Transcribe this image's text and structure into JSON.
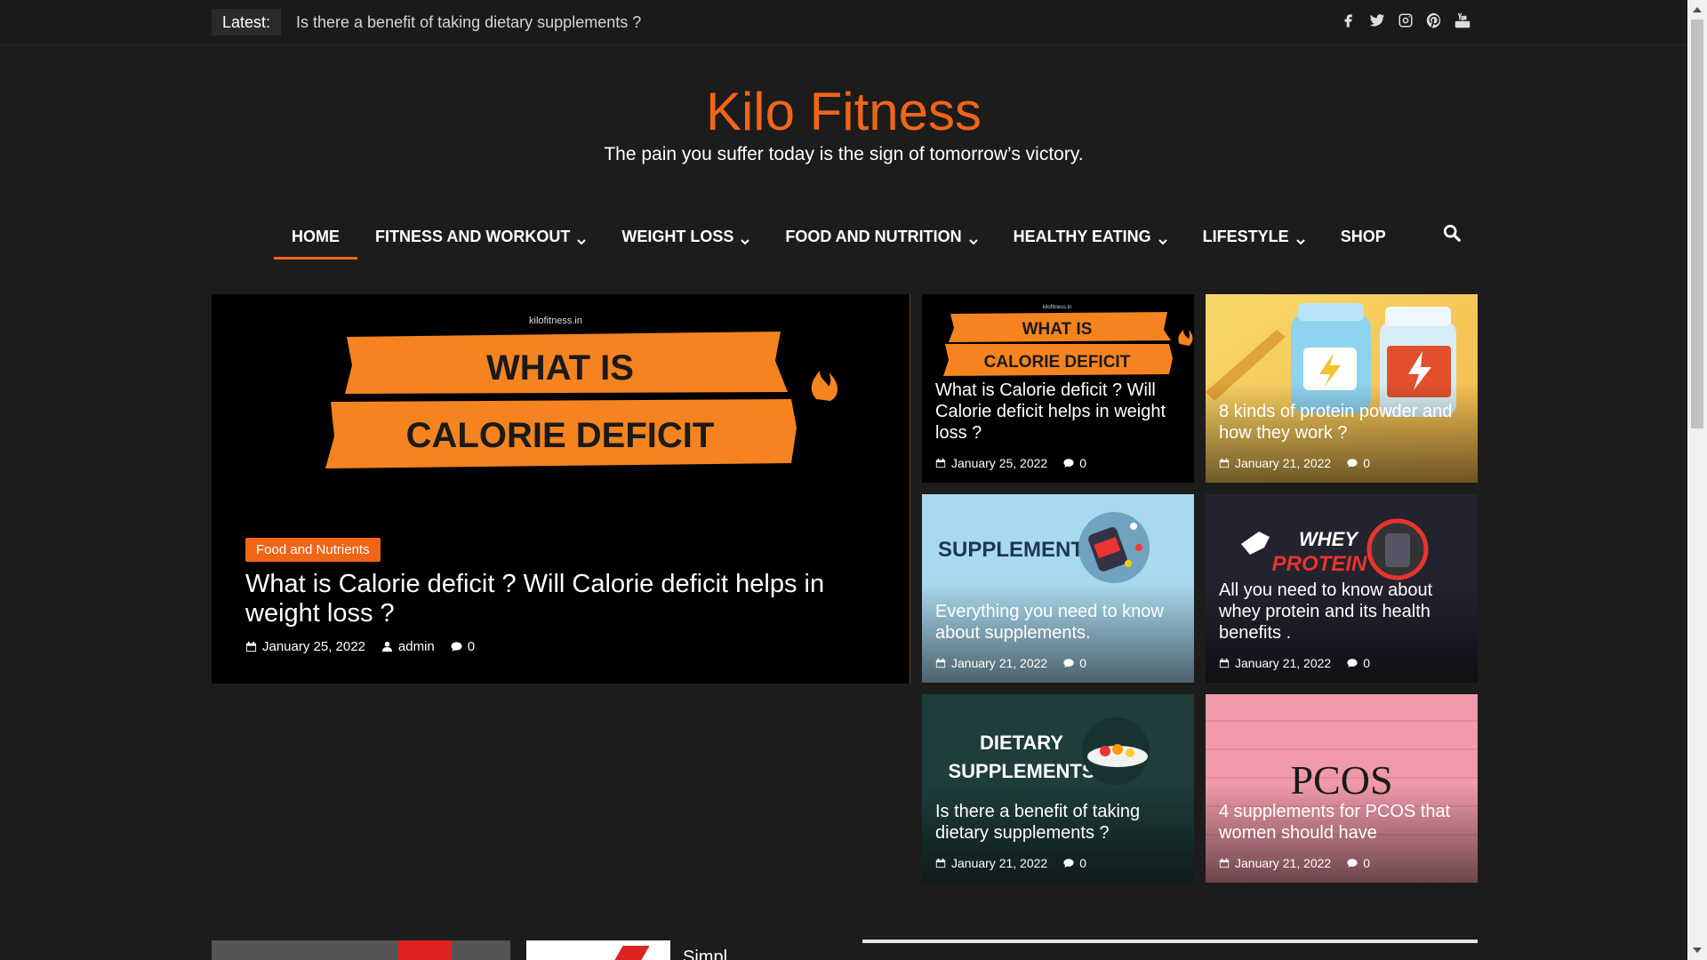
{
  "topbar": {
    "latest_label": "Latest:",
    "latest_text": "Is there a benefit of taking dietary supplements ?",
    "social_icons": [
      "facebook-icon",
      "twitter-icon",
      "instagram-icon",
      "pinterest-icon",
      "youtube-icon"
    ]
  },
  "header": {
    "title": "Kilo Fitness",
    "tagline": "The pain you suffer today is the sign of tomorrow’s victory."
  },
  "nav": {
    "items": [
      {
        "label": "HOME",
        "active": true,
        "dropdown": false
      },
      {
        "label": "FITNESS AND WORKOUT",
        "dropdown": true
      },
      {
        "label": "WEIGHT LOSS",
        "dropdown": true
      },
      {
        "label": "FOOD AND NUTRITION",
        "dropdown": true
      },
      {
        "label": "HEALTHY EATING",
        "dropdown": true
      },
      {
        "label": "LIFESTYLE",
        "dropdown": true
      },
      {
        "label": "SHOP",
        "dropdown": false
      }
    ]
  },
  "hero": {
    "image_site": "kilofitness.in",
    "image_line1": "WHAT IS",
    "image_line2": "CALORIE DEFICIT",
    "category": "Food and Nutrients",
    "title": "What is Calorie deficit ? Will Calorie deficit helps in weight loss ?",
    "date": "January 25, 2022",
    "author": "admin",
    "comments": "0"
  },
  "cards": [
    {
      "title": "What is Calorie deficit ? Will Calorie deficit helps in weight loss ?",
      "date": "January 25, 2022",
      "comments": "0",
      "img_line1": "WHAT IS",
      "img_line2": "CALORIE DEFICIT",
      "img_site": "kilofitness.in"
    },
    {
      "title": "8 kinds of protein powder and how they work ?",
      "date": "January 21, 2022",
      "comments": "0"
    },
    {
      "title": "Everything you need to know about supplements.",
      "date": "January 21, 2022",
      "comments": "0",
      "img_text": "SUPPLEMENTS"
    },
    {
      "title": "All you need to know about whey protein and its health benefits .",
      "date": "January 21, 2022",
      "comments": "0",
      "img_line1": "WHEY",
      "img_line2": "PROTEIN"
    },
    {
      "title": "Is there a benefit of taking dietary supplements ?",
      "date": "January 21, 2022",
      "comments": "0",
      "img_line1": "DIETARY",
      "img_line2": "SUPPLEMENTS"
    },
    {
      "title": "4 supplements for PCOS that women should have",
      "date": "January 21, 2022",
      "comments": "0",
      "img_text": "PCOS"
    }
  ],
  "bottom": {
    "partial_text": "Simpl"
  },
  "colors": {
    "accent": "#f16517",
    "background": "#1c1c1c"
  }
}
